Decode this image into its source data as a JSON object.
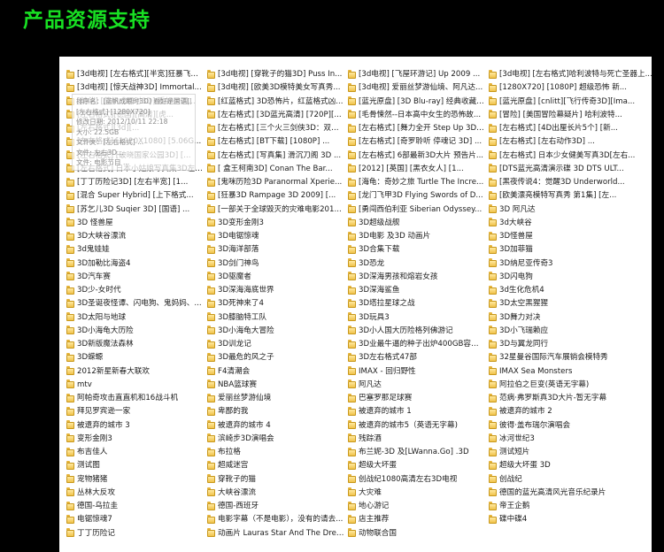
{
  "page": {
    "heading": "产品资源支持"
  },
  "colors": {
    "heading": "#18e023",
    "panel": "#ffffff",
    "background": "#000000",
    "folder": "#f0c24a"
  },
  "folders": [
    "[3d电视] [左右格式][半宽]狂暴飞车...",
    "[3d电视] [穿靴子的猫3D] Puss In...",
    "[3d电视] [飞屋环游记] Up 2009 ...",
    "[3d电视] [左右格式]哈利波特与死亡圣器上...",
    "[3d电视] [惊天战神3D] Immortal...",
    "[3d电视] [欧美3D模特美女写真秀...",
    "[3d电视] 爱丽丝梦游仙境、阿凡达...",
    "[1280X720] [1080P] 超级恐怖 新...",
    "[美俏] [蓝帆成眼时3D] 看好是国...",
    "[红蓝格式] 3D恐怖片，红蓝格式凶...",
    "[蓝光原盘] [3D Blu-ray] 经典收藏作...",
    "[蓝光原盘] [cnlitt][飞行传奇3D][Ima...",
    "[左右格式][德国][高清][虎...",
    "[左右格式] [3D蓝光高清] [720P][...",
    "[毛骨悚然--日本高中女生的恐怖故...",
    "[冒险] [美国冒险幕疑片] 哈利波特...",
    "[左右格式][3d][...",
    "[左右格式] [三个火三剑侠3D：双城...",
    "[左右格式] [舞力全开 Step Up 3D][...",
    "[左右格式] [4D出厘长片5个] [新...",
    "[左右格式] [1920X1080] [5.06G...",
    "[左右格式] [BT下载] [1080P] ...",
    "[左右格式] [奇罗聆听 停魂记 3D] ...",
    "[左右格式] [左右动作3D] ...",
    "[左右格式] [破晓国家公园3D] [...",
    "[左右格式] [写真集] 滑沉刀阁 3D ...",
    "[左右格式] 6部最新3D大片 预告片...",
    "[左右格式] 日本少女健美写真3D[左右...",
    "[左右格式] 日本小姑娘写真集3D左右...",
    "[  盒王柯南3D] Conan The Bar...",
    "[2012] [英国] [黑衣女人] [1...",
    "[DTS蓝光高清演示碟 3D DTS ULT...",
    "[丁丁历险记3D] [左右半宽] [1...",
    "[鬼咪历险3D Paranormal Xperie...",
    "[海龟：奇妙之旅 Turtle The Incre...",
    "[黑夜传说4：觉醒3D Underworld...",
    "[混合 Super Hybrid] [上下格式...",
    "[狂暴3D Rampage 3D 2009] [...",
    "[龙门飞甲3D Flying Swords of D...",
    "[欧美漂亮模特写真秀 第1集] [左...",
    "[苏乞儿3D Suqier 3D] [国语] ...",
    "[一部关于全球毁灭的灾难电影201...",
    "[勇闯西伯利亚 Siberian Odyssey...",
    "3D 阿凡达",
    "3D 怪兽屋",
    "3D变形金刚3",
    "3D超级战舰",
    "3d大峡谷",
    "3D大峡谷漂流",
    "3D电锯惊魂",
    "3D电影 及3D 动画片",
    "3D怪兽屋",
    "3d鬼娃娃",
    "3D海洋部落",
    "3D合集下载",
    "3D加菲猫",
    "3D加勒比海盗4",
    "3D剑门神鸟",
    "3D恐龙",
    "3D纳尼亚传奇3",
    "3D汽车赛",
    "3D驱魔者",
    "3D深海男孩和熔岩女孩",
    "3D闪电狗",
    "3D少-女时代",
    "3D深海海底世界",
    "3D深海鲨鱼",
    "3d生化危机4",
    "3D圣诞夜怪谭、闪电狗、鬼妈妈、...",
    "3D死神来了4",
    "3D塔拉星球之战",
    "3D太空黑猩猩",
    "3D太阳与地球",
    "3D膝脑特工队",
    "3D玩具3",
    "3D舞力对决",
    "3D小海龟大历险",
    "3D小海龟大冒险",
    "3D小人国大历险格列佛游记",
    "3D小飞瑞赖应",
    "3D新版魔法森林",
    "3D训龙记",
    "3D业最牛逼的种子出炉400GB容量1...",
    "3D与翼龙同行",
    "3D蝾螈",
    "3D最危的风之子",
    "3D左右格式47部",
    "32星曼谷国际汽车展销会模特秀",
    "2012新星新春大联欢",
    "F4清潮会",
    "IMAX - 回归野性",
    "IMAX Sea Monsters",
    "mtv",
    "NBA篮球赛",
    "阿凡达",
    "阿拉伯之巨变(英语无字幕)",
    "阿帕奇攻击直直机和16战斗机",
    "爱丽丝梦游仙境",
    "巴塞罗那足球赛",
    "范病·弗罗斯真3D大片-暂无字幕",
    "拜见罗宾逊一家",
    "卑鄙的我",
    "被遗弃的城市 1",
    "被遗弃的城市 2",
    "被遗弃的城市 3",
    "被遗弃的城市 4",
    "被遗弃的城市5（英语无字幕)",
    "彼得·盖布瑞尔演唱会",
    "变形金刚3",
    "滨崎步3D演唱会",
    "残踪酒",
    "冰河世纪3",
    "布吉佳人",
    "布拉格",
    "布兰妮-3D 及[LWanna.Go] .3D",
    "测试短片",
    "测试图",
    "超威迷宫",
    "超级大坏蛋",
    "超级大坏蛋 3D",
    "宠物猪猪",
    "穿靴子的猫",
    "创战纪1080高清左右3D电视",
    "创战纪",
    "丛林大反攻",
    "大峡谷漂流",
    "大灾难",
    "德国的蓝光高清风光音乐纪录片",
    "德国-乌拉圭",
    "德国-西班牙",
    "地心游记",
    "帝王企鹅",
    "电锯惊魂7",
    "电影字幕（不是电影），没有的请去...",
    "店主推荐",
    "碟中碟4",
    "丁丁历险记",
    "动画片 Lauras Star And The Drea...",
    "动物联合国"
  ],
  "tooltip": {
    "name": "排序名：[蓝帆成眼时3D] 看好是国语[国语]",
    "type": "[左右格式] [1280X720]",
    "modified": "修改日期: 2012/10/11 22:18",
    "size": "大小: 22.5GB",
    "folder": "文件夹：[左右格式] ...",
    "files": "文件: 左右3D...",
    "extra": "文件: 电影节目 ..."
  }
}
